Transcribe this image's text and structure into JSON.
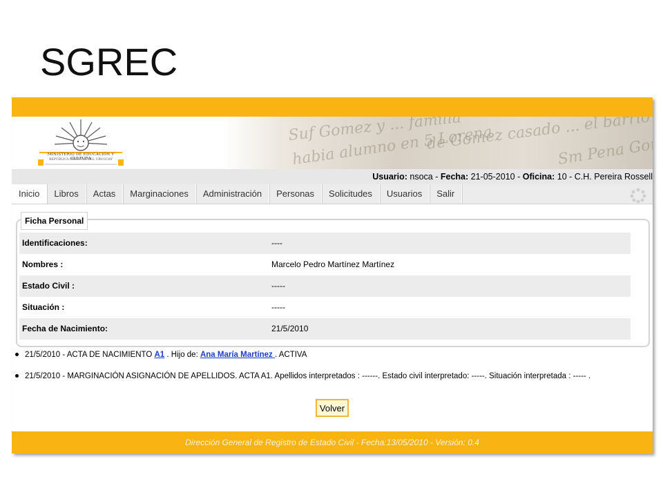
{
  "slide": {
    "title": "SGREC"
  },
  "header": {
    "logo_text_line1": "MINISTERIO DE EDUCACIÓN Y CULTURA",
    "logo_text_line2": "REPÚBLICA ORIENTAL DEL URUGUAY",
    "banner_script": [
      "Suf Gomez y ... familia",
      "habia alumno en 5 Lorena",
      "de Gomez casado ... el barrio",
      "Sm Pena Gomez"
    ]
  },
  "userbar": {
    "usuario_label": "Usuario:",
    "usuario_value": "nsoca",
    "fecha_label": "Fecha:",
    "fecha_value": "21-05-2010",
    "oficina_label": "Oficina:",
    "oficina_value": "10 - C.H. Pereira Rossell",
    "separator": " - "
  },
  "nav": {
    "tabs": [
      {
        "label": "Inicio"
      },
      {
        "label": "Libros"
      },
      {
        "label": "Actas"
      },
      {
        "label": "Marginaciones"
      },
      {
        "label": "Administración"
      },
      {
        "label": "Personas"
      },
      {
        "label": "Solicitudes"
      },
      {
        "label": "Usuarios"
      },
      {
        "label": "Salir"
      }
    ],
    "active_index": 0
  },
  "ficha": {
    "legend": "Ficha Personal",
    "rows": [
      {
        "label": "Identificaciones:",
        "value": "----"
      },
      {
        "label": "Nombres :",
        "value": "Marcelo Pedro Martínez Martínez"
      },
      {
        "label": "Estado Civil :",
        "value": "-----"
      },
      {
        "label": "Situación :",
        "value": "-----"
      },
      {
        "label": "Fecha de Nacimiento:",
        "value": "21/5/2010"
      }
    ]
  },
  "notes": {
    "acta": {
      "prefix": "21/5/2010 - ACTA DE NACIMIENTO ",
      "acta_link": "A1",
      "mid": " . Hijo de: ",
      "parent_link": "Ana María Martínez ",
      "suffix": " . ACTIVA"
    },
    "marginacion": {
      "text": "21/5/2010 - MARGINACIÓN ASIGNACIÓN DE APELLIDOS. ACTA A1. Apellidos interpretados : ------. Estado civil interpretado: -----. Situación interpretada : ----- ."
    }
  },
  "actions": {
    "volver_label": "Volver"
  },
  "footer": {
    "text": "Dirección General de Registro de Estado Civil - Fecha:13/05/2010 - Versión: 0.4"
  },
  "colors": {
    "accent": "#f9b312",
    "link": "#1a3fc5",
    "row_shade": "#ececec"
  }
}
